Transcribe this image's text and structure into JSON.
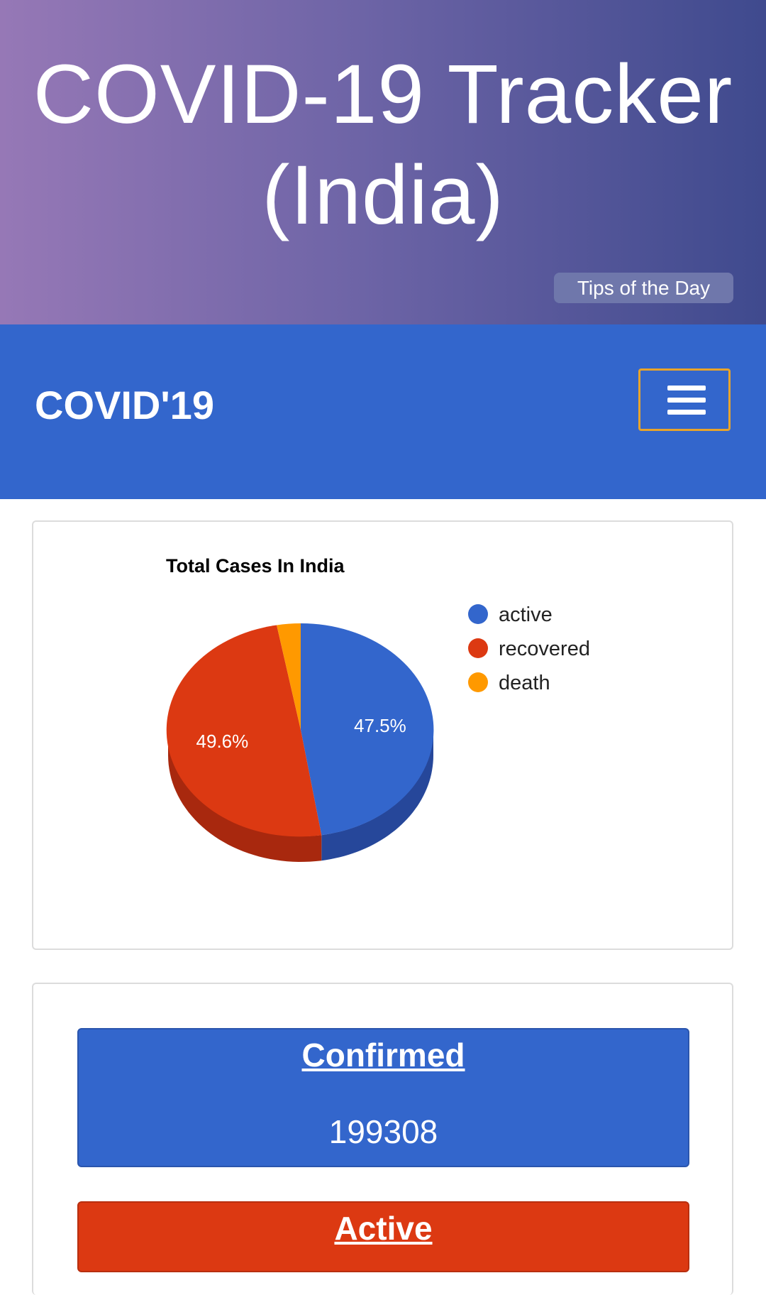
{
  "header": {
    "title_line1": "COVID-19 Tracker",
    "title_line2": "(India)",
    "tips_button": "Tips of the Day"
  },
  "navbar": {
    "brand": "COVID'19",
    "menu_icon": "hamburger-menu-icon"
  },
  "colors": {
    "active": "#3366cc",
    "recovered": "#dc3912",
    "death": "#ff9900",
    "navbar": "#3366cc"
  },
  "chart_data": {
    "type": "pie",
    "title": "Total Cases In India",
    "categories": [
      "active",
      "recovered",
      "death"
    ],
    "values": [
      47.5,
      49.6,
      2.9
    ],
    "data_labels": [
      "47.5%",
      "49.6%",
      ""
    ],
    "legend_position": "right",
    "three_d": true
  },
  "stats": {
    "confirmed": {
      "label": "Confirmed",
      "value": "199308"
    },
    "active": {
      "label": "Active"
    }
  }
}
